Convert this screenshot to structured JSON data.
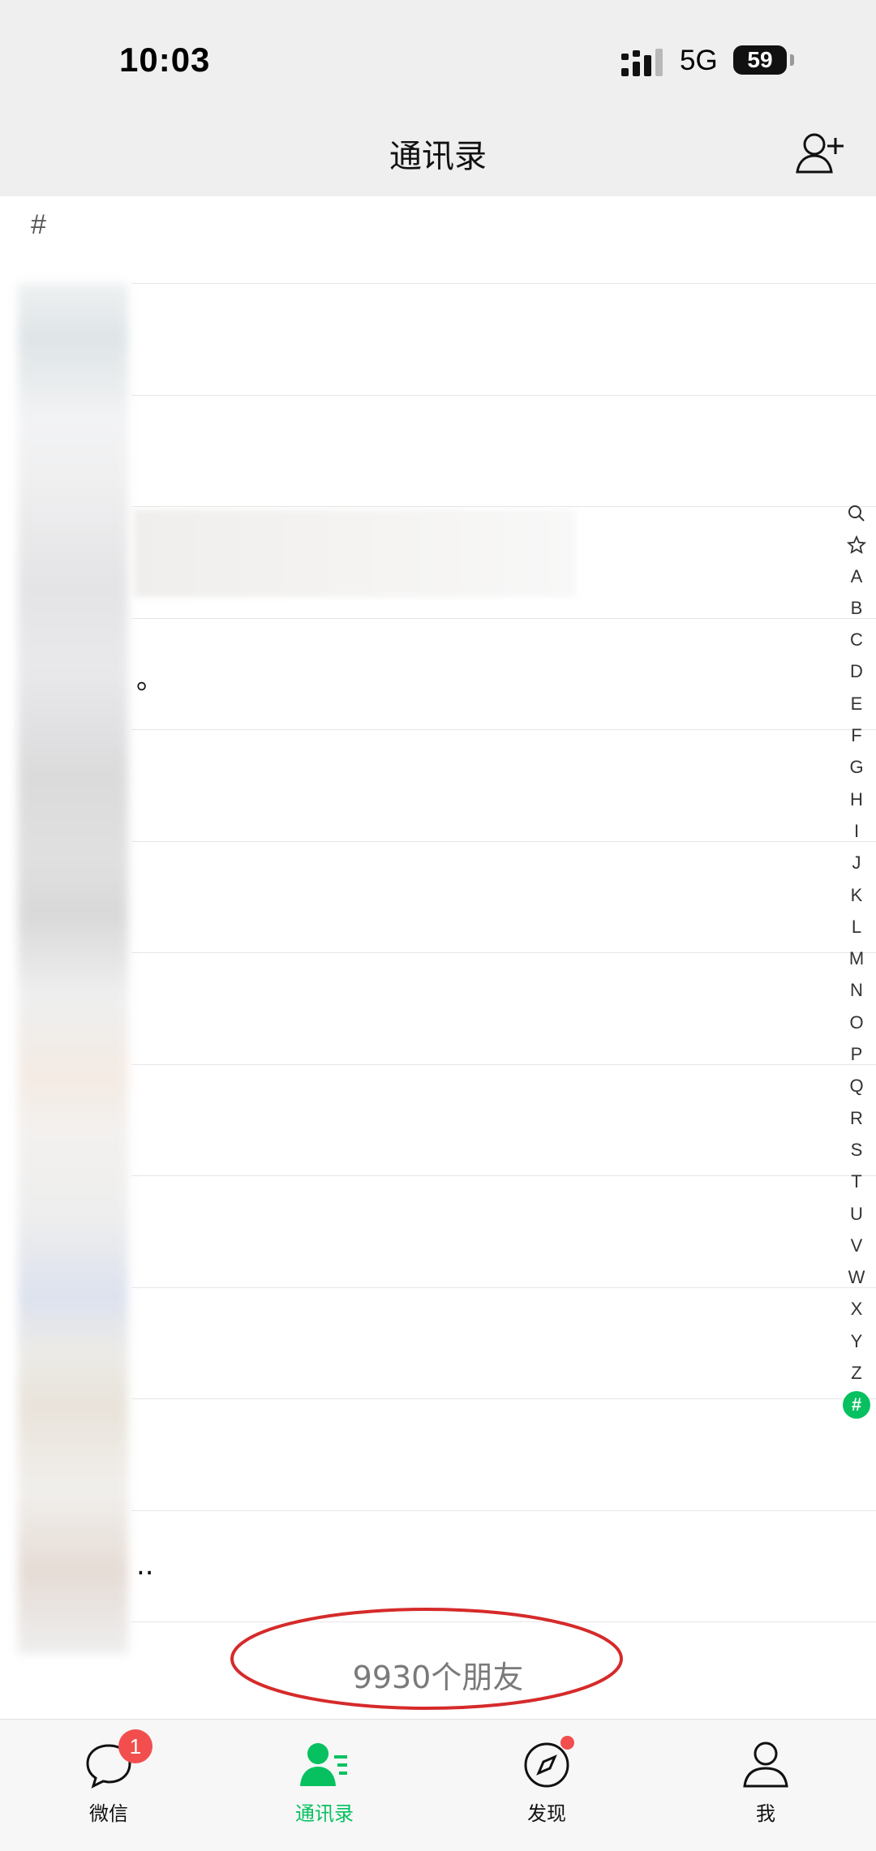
{
  "status_bar": {
    "time": "10:03",
    "network": "5G",
    "battery": "59"
  },
  "header": {
    "title": "通讯录",
    "add_icon": "add-contact-icon"
  },
  "section": {
    "letter": "#"
  },
  "contacts": [
    {
      "name": ""
    },
    {
      "name": ""
    },
    {
      "name": ""
    },
    {
      "name": "。"
    },
    {
      "name": ""
    },
    {
      "name": ""
    },
    {
      "name": ""
    },
    {
      "name": ""
    },
    {
      "name": ""
    },
    {
      "name": ""
    },
    {
      "name": ""
    },
    {
      "name": ".."
    }
  ],
  "index_letters": [
    "search",
    "star",
    "A",
    "B",
    "C",
    "D",
    "E",
    "F",
    "G",
    "H",
    "I",
    "J",
    "K",
    "L",
    "M",
    "N",
    "O",
    "P",
    "Q",
    "R",
    "S",
    "T",
    "U",
    "V",
    "W",
    "X",
    "Y",
    "Z",
    "#"
  ],
  "index_labels": {
    "A": "A",
    "B": "B",
    "C": "C",
    "D": "D",
    "E": "E",
    "F": "F",
    "G": "G",
    "H": "H",
    "I": "I",
    "J": "J",
    "K": "K",
    "L": "L",
    "M": "M",
    "N": "N",
    "O": "O",
    "P": "P",
    "Q": "Q",
    "R": "R",
    "S": "S",
    "T": "T",
    "U": "U",
    "V": "V",
    "W": "W",
    "X": "X",
    "Y": "Y",
    "Z": "Z",
    "#": "#"
  },
  "friend_count": "9930个朋友",
  "tabs": [
    {
      "label": "微信",
      "icon": "chat-icon",
      "badge": "1"
    },
    {
      "label": "通讯录",
      "icon": "contacts-icon",
      "active": true
    },
    {
      "label": "发现",
      "icon": "compass-icon",
      "dot": true
    },
    {
      "label": "我",
      "icon": "person-icon"
    }
  ],
  "colors": {
    "accent": "#07c160",
    "badge": "#f24e4e",
    "annotation": "#d62a2a"
  }
}
